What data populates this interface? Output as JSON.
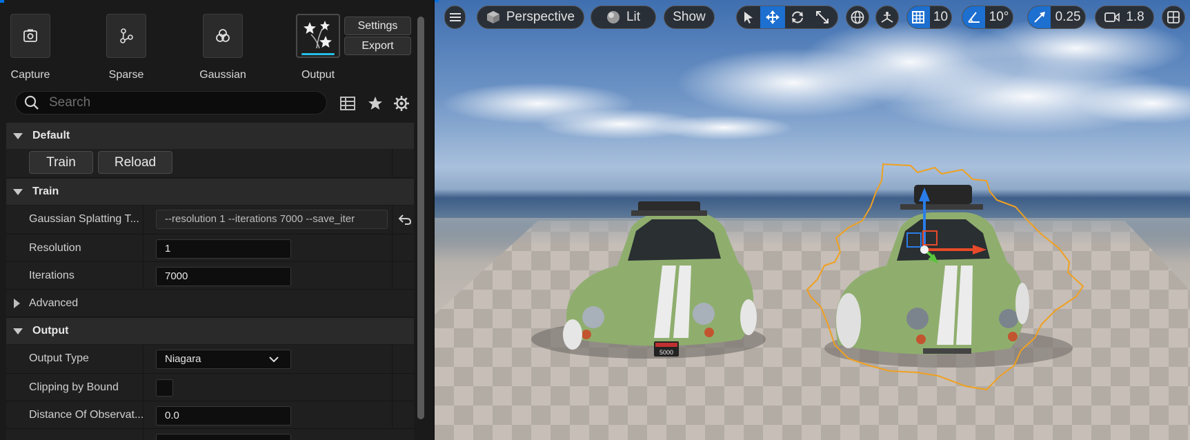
{
  "toolbar": {
    "tools": [
      {
        "label": "Capture",
        "icon": "camera-icon"
      },
      {
        "label": "Sparse",
        "icon": "sparse-nodes-icon"
      },
      {
        "label": "Gaussian",
        "icon": "gaussian-circles-icon"
      },
      {
        "label": "Output",
        "icon": "stars-output-icon"
      }
    ],
    "settings_label": "Settings",
    "export_label": "Export"
  },
  "search": {
    "placeholder": "Search"
  },
  "sections": {
    "default": {
      "title": "Default",
      "train_label": "Train",
      "reload_label": "Reload"
    },
    "train": {
      "title": "Train",
      "gs_label": "Gaussian Splatting T...",
      "gs_value": "--resolution 1 --iterations 7000 --save_iter",
      "resolution_label": "Resolution",
      "resolution_value": "1",
      "iterations_label": "Iterations",
      "iterations_value": "7000"
    },
    "advanced": {
      "title": "Advanced"
    },
    "output": {
      "title": "Output",
      "output_type_label": "Output Type",
      "output_type_value": "Niagara",
      "clipping_label": "Clipping by Bound",
      "clipping_checked": false,
      "distance_label": "Distance Of Observat...",
      "distance_value": "0.0"
    }
  },
  "viewport": {
    "perspective_label": "Perspective",
    "lit_label": "Lit",
    "show_label": "Show",
    "grid_snap": "10",
    "angle_snap": "10°",
    "scale_snap": "0.25",
    "camera_speed": "1.8",
    "plate_text": "5000",
    "colors": {
      "accent": "#1d6fd0",
      "selection": "#f0a020",
      "car": "#8fae6e"
    }
  }
}
